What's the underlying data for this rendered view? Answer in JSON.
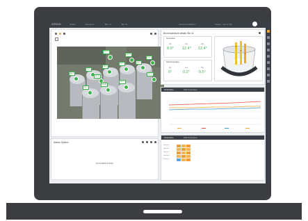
{
  "app": {
    "logo": "iGRAIN",
    "breadcrumb": [
      "Sealer",
      "Elevators",
      "Bin 1.1",
      "Bin 41"
    ],
    "right_items": [
      "Aiscience platform",
      "Sealer - Sec 2 Car"
    ]
  },
  "map_panel": {
    "tags": [
      "Bin 1.1",
      "Bin 2.1",
      "Bin 3",
      "Bin 4",
      "Bin 5",
      "Bin 6",
      "Bin 7",
      "Bin 8",
      "Bin 9",
      "Bin 10",
      "Bin 11",
      "Bin 12",
      "Bin 13"
    ]
  },
  "alarm_panel": {
    "title": "Alarms System",
    "empty_message": "NO ALARMS FOUND"
  },
  "detail_panel": {
    "title": "Bin temperature details: Bin 41",
    "temperature_box": {
      "title": "Temperature",
      "items": [
        {
          "label": "Min",
          "value": "8.9°"
        },
        {
          "label": "Avg",
          "value": "12.4°"
        },
        {
          "label": "Max",
          "value": "12.4°"
        }
      ]
    },
    "delta_box": {
      "title": "Delta Temperature",
      "items": [
        {
          "label": "Min",
          "value": "0°"
        },
        {
          "label": "Avg",
          "value": "0.2°"
        },
        {
          "label": "Max",
          "value": "0.5°"
        }
      ]
    }
  },
  "trend_panel": {
    "tabs": [
      "Temperature",
      "Delta Temperature"
    ]
  },
  "table_panel": {
    "tabs": [
      "Temperature",
      "Delta Temperature"
    ],
    "rows": [
      "Sensor 1",
      "Sensor 2",
      "Sensor 3",
      "Sensor 4",
      "Sensor 5"
    ]
  },
  "colors": {
    "accent_green": "#3bb54a",
    "accent_orange": "#f1a83b",
    "dark_chrome": "#3a3f46"
  }
}
